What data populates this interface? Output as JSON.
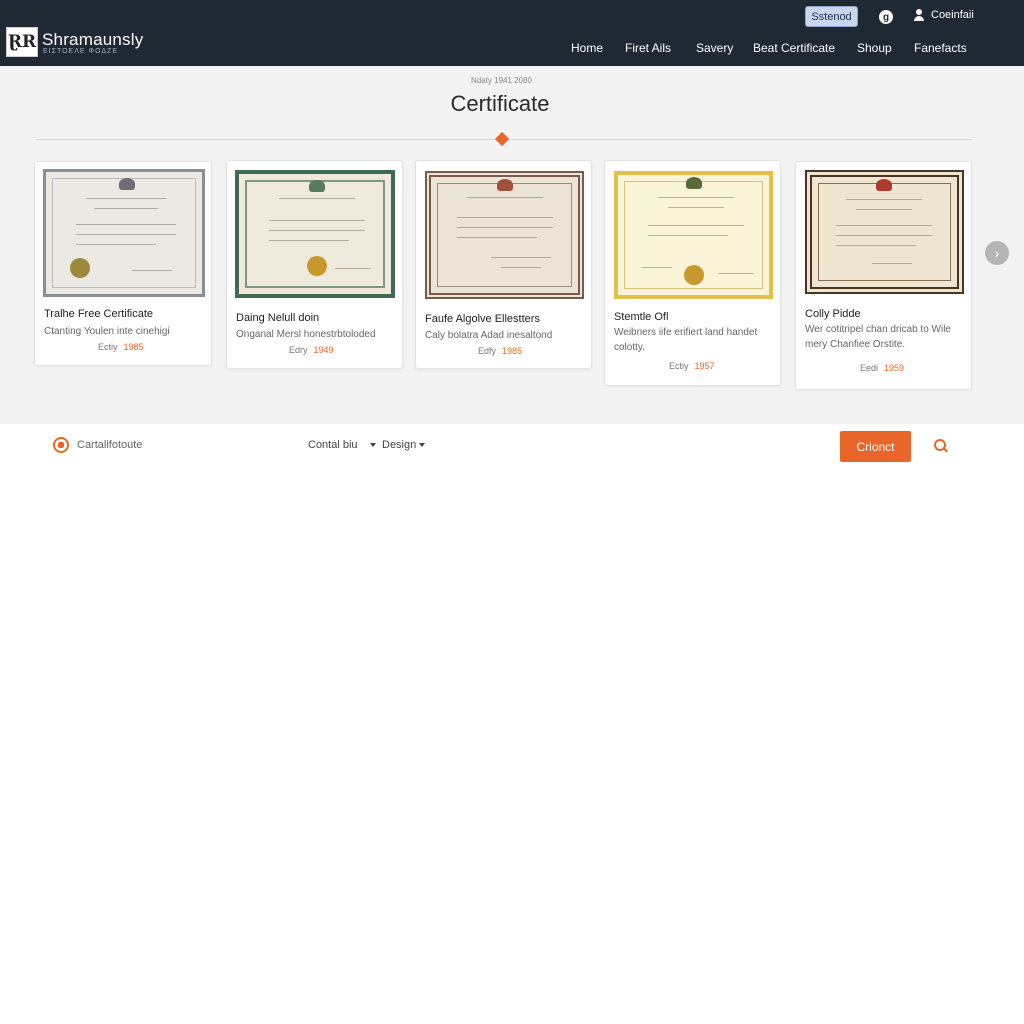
{
  "brand": {
    "name": "Shramaunsly",
    "tagline": "ΕΙΣΤΟΕΛΕ ΦΟΔΖΕ"
  },
  "topbar": {
    "button_label": "Sstenod",
    "circle_label": "g",
    "user_label": "Coeinfaii"
  },
  "nav": [
    "Home",
    "Firet Ails",
    "Savery",
    "Beat Certificate",
    "Shoup",
    "Fanefacts"
  ],
  "hero": {
    "date": "Ndaty 1941 2080",
    "title": "Certificate"
  },
  "cards": [
    {
      "title": "Tralhe Free Certificate",
      "desc": "Ctanting Youlen inte cinehigi",
      "meta": "Ectiy",
      "year": "1985",
      "accent": "#8a8f96"
    },
    {
      "title": "Daing Nelull doin",
      "desc": "Onganal Mersl honestrbtoloded",
      "meta": "Edry",
      "year": "1949",
      "accent": "#3f6b52"
    },
    {
      "title": "Faufe Algolve Ellestters",
      "desc": "Caly bolatra Adad inesaltond",
      "meta": "Edfy",
      "year": "1985",
      "accent": "#7a5a4a"
    },
    {
      "title": "Stemtle Ofl",
      "desc": "Weibners iife erifiert land handet colotty.",
      "meta": "Ectiy",
      "year": "1957",
      "accent": "#e2c04a"
    },
    {
      "title": "Colly Pidde",
      "desc": "Wer cotitripel chan dricab to Wile mery Chanfiee Orstite.",
      "meta": "Eedi",
      "year": "1959",
      "accent": "#4a3322"
    }
  ],
  "toolbar": {
    "label": "Cartalifotoute",
    "dropdown1": "Contal biu",
    "dropdown2": "Design",
    "create_label": "Crionct"
  }
}
